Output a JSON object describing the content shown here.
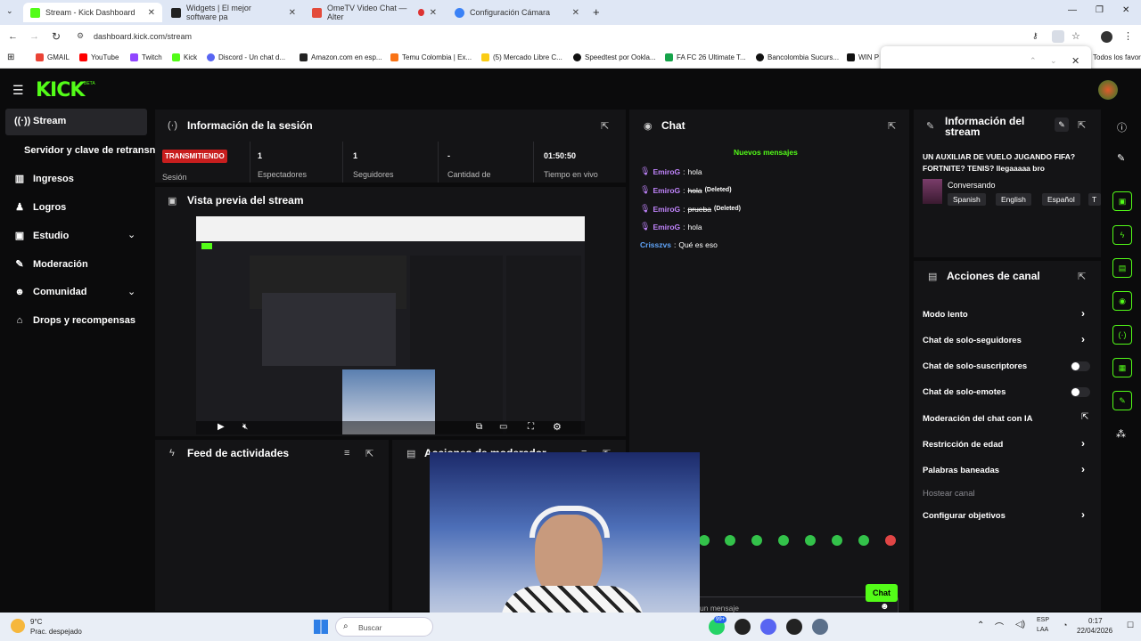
{
  "browser": {
    "tabs": [
      {
        "title": "Stream - Kick Dashboard",
        "color": "#53fc18"
      },
      {
        "title": "Widgets | El mejor software pa",
        "color": "#222222"
      },
      {
        "title": "OmeTV Video Chat — Alter",
        "color": "#e34b3b"
      },
      {
        "title": "Configuración Cámara",
        "color": "#3b82f6"
      }
    ],
    "url": "dashboard.kick.com/stream",
    "bookmarks": [
      {
        "label": "GMAIL",
        "color": "#ea4335"
      },
      {
        "label": "YouTube",
        "color": "#ff0000"
      },
      {
        "label": "Twitch",
        "color": "#9146ff"
      },
      {
        "label": "Kick",
        "color": "#53fc18"
      },
      {
        "label": "Discord - Un chat d...",
        "color": "#5865f2"
      },
      {
        "label": "Amazon.com en esp...",
        "color": "#222222"
      },
      {
        "label": "Temu Colombia | Ex...",
        "color": "#f97316"
      },
      {
        "label": "(5) Mercado Libre C...",
        "color": "#facc15"
      },
      {
        "label": "Speedtest por Ookla...",
        "color": "#111111"
      },
      {
        "label": "FA FC 26 Ultimate T...",
        "color": "#16a34a"
      },
      {
        "label": "Bancolombia Sucurs...",
        "color": "#111111"
      },
      {
        "label": "WIN P",
        "color": "#111111"
      }
    ],
    "bookmarks_right": "Todos los favoritos"
  },
  "brand": {
    "logo": "KICK",
    "beta": "BETA",
    "accent": "#53fc18"
  },
  "sidebar": {
    "items": [
      {
        "label": "Stream",
        "icon": "broadcast-icon"
      },
      {
        "label": "Servidor y clave de retransn",
        "icon": ""
      },
      {
        "label": "Ingresos",
        "icon": "chart-icon"
      },
      {
        "label": "Logros",
        "icon": "trophy-icon"
      },
      {
        "label": "Estudio",
        "icon": "studio-icon"
      },
      {
        "label": "Moderación",
        "icon": "wrench-icon"
      },
      {
        "label": "Comunidad",
        "icon": "users-icon"
      },
      {
        "label": "Drops y recompensas",
        "icon": "gift-icon"
      }
    ]
  },
  "session": {
    "title": "Información de la sesión",
    "live_badge": "TRANSMITIENDO",
    "session_label": "Sesión",
    "stats": [
      {
        "value": "1",
        "label": "Espectadores"
      },
      {
        "value": "1",
        "label": "Seguidores"
      },
      {
        "value": "-",
        "label": "Cantidad de"
      },
      {
        "value": "01:50:50",
        "label": "Tiempo en vivo"
      }
    ]
  },
  "preview": {
    "title": "Vista previa del stream"
  },
  "feed": {
    "title": "Feed de actividades"
  },
  "modactions": {
    "title": "Acciones de moderador"
  },
  "chat": {
    "title": "Chat",
    "new_messages": "Nuevos mensajes",
    "messages": [
      {
        "user": "EmiroG",
        "text": "hola",
        "deleted": "",
        "color": "#c084fc"
      },
      {
        "user": "EmiroG",
        "text": "hola",
        "deleted": "(Deleted)",
        "color": "#c084fc"
      },
      {
        "user": "EmiroG",
        "text": "prueba",
        "deleted": "(Deleted)",
        "color": "#c084fc"
      },
      {
        "user": "EmiroG",
        "text": "hola",
        "deleted": "",
        "color": "#c084fc"
      },
      {
        "user": "Crisszvs",
        "text": "Qué es eso",
        "deleted": "",
        "color": "#60a5fa"
      }
    ],
    "input_placeholder": "un mensaje",
    "send_label": "Chat"
  },
  "stream_info": {
    "title_line1": "Información del",
    "title_line2": "stream",
    "stream_title": "UN AUXILIAR DE VUELO JUGANDO FIFA? FORTNITE? TENIS? llegaaaaa bro",
    "category": "Conversando",
    "tags": [
      "Spanish",
      "English",
      "Español",
      "T"
    ]
  },
  "channel_actions": {
    "title": "Acciones de canal",
    "items": [
      {
        "label": "Modo lento",
        "control": "chevron"
      },
      {
        "label": "Chat de solo-seguidores",
        "control": "chevron"
      },
      {
        "label": "Chat de solo-suscriptores",
        "control": "toggle"
      },
      {
        "label": "Chat de solo-emotes",
        "control": "toggle"
      },
      {
        "label": "Moderación del chat con IA",
        "control": "external"
      },
      {
        "label": "Restricción de edad",
        "control": "chevron"
      },
      {
        "label": "Palabras baneadas",
        "control": "chevron"
      },
      {
        "label": "Hostear canal",
        "control": "none"
      },
      {
        "label": "Configurar objetivos",
        "control": "chevron"
      }
    ]
  },
  "taskbar": {
    "weather_temp": "9°C",
    "weather_desc": "Prac. despejado",
    "search": "Buscar",
    "badge": "99+",
    "lang1": "ESP",
    "lang2": "LAA",
    "time": "0:17",
    "date": "22/04/2026"
  }
}
